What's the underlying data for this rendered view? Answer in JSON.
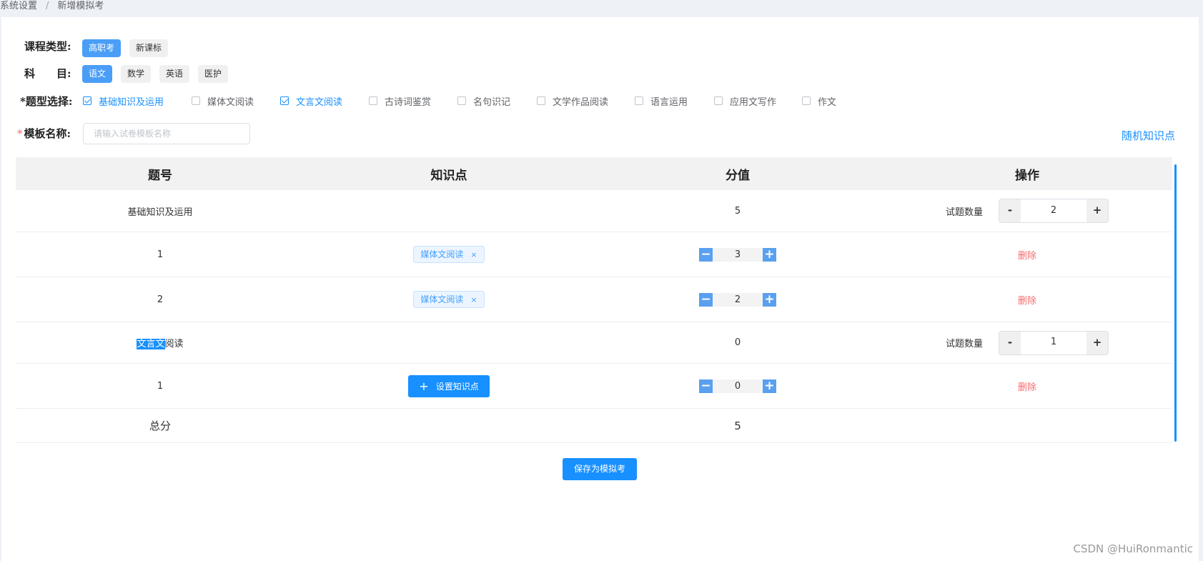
{
  "breadcrumb": {
    "items": [
      "系统设置",
      "新增模拟考"
    ],
    "separator": "/"
  },
  "course_type": {
    "label": "课程类型:",
    "options": [
      {
        "label": "高职考",
        "active": true
      },
      {
        "label": "新课标",
        "active": false
      }
    ]
  },
  "subject": {
    "label": "科　　目:",
    "options": [
      {
        "label": "语文",
        "active": true
      },
      {
        "label": "数学",
        "active": false
      },
      {
        "label": "英语",
        "active": false
      },
      {
        "label": "医护",
        "active": false
      }
    ]
  },
  "question_types": {
    "label": "*题型选择:",
    "options": [
      {
        "label": "基础知识及运用",
        "checked": true
      },
      {
        "label": "媒体文阅读",
        "checked": false
      },
      {
        "label": "文言文阅读",
        "checked": true
      },
      {
        "label": "古诗词鉴赏",
        "checked": false
      },
      {
        "label": "名句识记",
        "checked": false
      },
      {
        "label": "文学作品阅读",
        "checked": false
      },
      {
        "label": "语言运用",
        "checked": false
      },
      {
        "label": "应用文写作",
        "checked": false
      },
      {
        "label": "作文",
        "checked": false
      }
    ]
  },
  "template_name": {
    "required_mark": "*",
    "label": "模板名称:",
    "placeholder": "请输入试卷模板名称",
    "value": ""
  },
  "random_link": "随机知识点",
  "table": {
    "headers": [
      "题号",
      "知识点",
      "分值",
      "操作"
    ],
    "sections": [
      {
        "title": "基础知识及运用",
        "score": "5",
        "count_label": "试题数量",
        "count": "2",
        "minus": "-",
        "plus": "+",
        "rows": [
          {
            "no": "1",
            "tag": "媒体文阅读",
            "tag_close": "×",
            "score": "3",
            "action": "删除"
          },
          {
            "no": "2",
            "tag": "媒体文阅读",
            "tag_close": "×",
            "score": "2",
            "action": "删除"
          }
        ]
      },
      {
        "title_selected": "文言文",
        "title_rest": "阅读",
        "score": "0",
        "count_label": "试题数量",
        "count": "1",
        "minus": "-",
        "plus": "+",
        "rows": [
          {
            "no": "1",
            "button_label": "设置知识点",
            "button_icon": "+",
            "score": "0",
            "action": "删除"
          }
        ]
      }
    ],
    "total_label": "总分",
    "total_value": "5"
  },
  "save_button": "保存为模拟考",
  "watermark": "CSDN @HuiRonmantic",
  "icons": {
    "score_minus": "−",
    "score_plus": "+"
  },
  "colors": {
    "primary": "#1890ff",
    "chip_active": "#4a9ef8",
    "danger": "#f56c6c",
    "header_bg": "#f2f2f2"
  }
}
